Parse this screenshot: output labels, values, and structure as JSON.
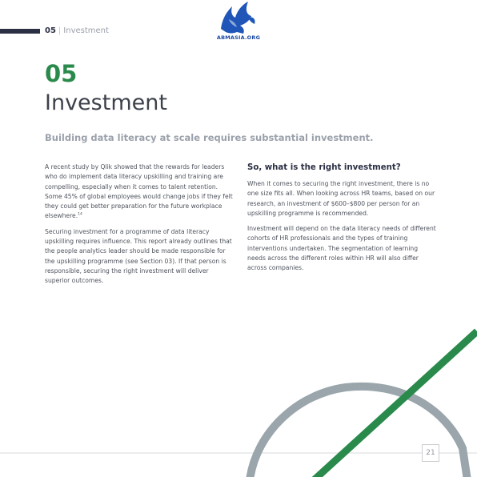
{
  "header": {
    "section_number": "05",
    "section_label": "Investment",
    "logo_text": "ABMASIA.ORG"
  },
  "chapter": {
    "number": "05",
    "title": "Investment",
    "lead": "Building data literacy at scale requires substantial investment."
  },
  "left_column": {
    "paragraphs": [
      "A recent study by Qlik showed that the rewards for leaders who do implement data literacy upskilling and training are compelling, especially when it comes to talent retention. Some 45% of global employees would change jobs if they felt they could get better preparation for the future workplace elsewhere.",
      "Securing investment for a programme of data literacy upskilling requires influence. This report already outlines that the people analytics leader should be made responsible for the upskilling programme (see Section 03). If that person is responsible, securing the right investment will deliver superior outcomes."
    ],
    "footnote_ref": "14"
  },
  "right_column": {
    "heading": "So, what is the right investment?",
    "paragraphs": [
      "When it comes to securing the right investment, there is no one size fits all. When looking across HR teams, based on our research, an investment of $600–$800 per person for an upskilling programme is recommended.",
      "Investment will depend on the data literacy needs of different cohorts of HR professionals and the types of training interventions undertaken. The segmentation of learning needs across the different roles within HR will also differ across companies."
    ]
  },
  "footer": {
    "page_number": "21"
  },
  "colors": {
    "accent_green": "#2a8a4c",
    "navy": "#2b3044",
    "arc_gray": "#9aa6ab"
  },
  "icons": {
    "logo": "winged-lion-logo"
  }
}
